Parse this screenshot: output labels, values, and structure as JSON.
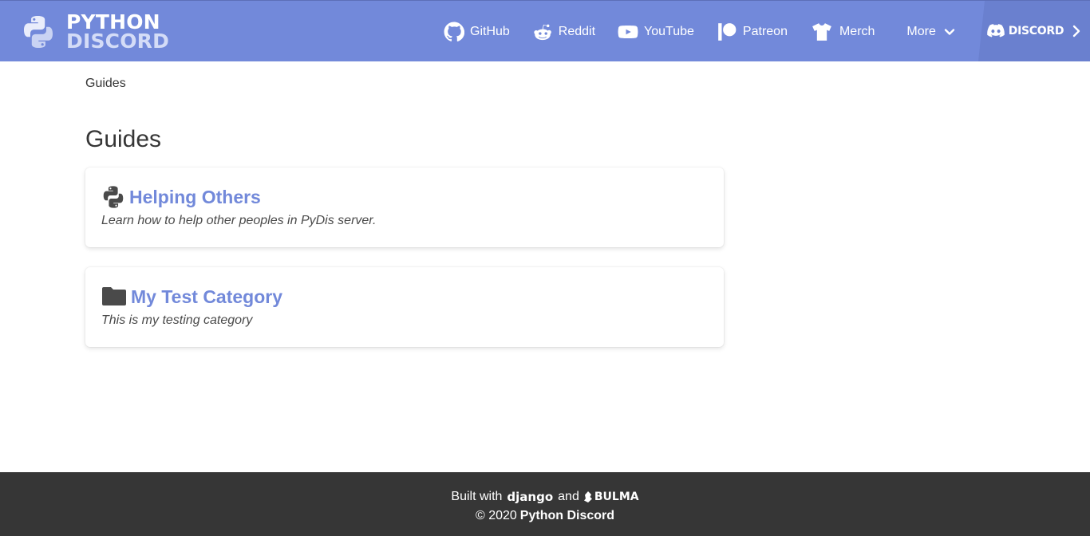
{
  "brand": {
    "line1": "PYTHON",
    "line2": "DISCORD"
  },
  "nav": {
    "items": [
      {
        "label": "GitHub",
        "icon": "github-icon"
      },
      {
        "label": "Reddit",
        "icon": "reddit-icon"
      },
      {
        "label": "YouTube",
        "icon": "youtube-icon"
      },
      {
        "label": "Patreon",
        "icon": "patreon-icon"
      },
      {
        "label": "Merch",
        "icon": "tshirt-icon"
      }
    ],
    "more_label": "More",
    "discord_label": "DISCORD"
  },
  "breadcrumb": "Guides",
  "page_title": "Guides",
  "cards": [
    {
      "title": "Helping Others",
      "description": "Learn how to help other peoples in PyDis server.",
      "icon": "python-icon"
    },
    {
      "title": "My Test Category",
      "description": "This is my testing category",
      "icon": "folder-icon"
    }
  ],
  "footer": {
    "built_with": "Built with",
    "django": "django",
    "and": "and",
    "bulma": "BULMA",
    "copyright": "© 2020",
    "org": "Python Discord"
  },
  "colors": {
    "accent": "#7289da",
    "footer_bg": "#363636",
    "discord_bg": "#6a80cf"
  }
}
